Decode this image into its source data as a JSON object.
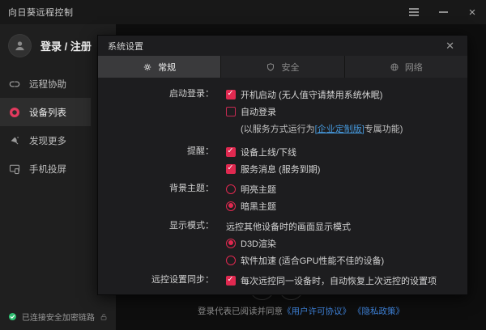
{
  "titlebar": {
    "title": "向日葵远程控制"
  },
  "sidebar": {
    "login": "登录 / 注册",
    "nav": [
      {
        "label": "远程协助"
      },
      {
        "label": "设备列表"
      },
      {
        "label": "发现更多"
      },
      {
        "label": "手机投屏"
      }
    ],
    "secure_status": "已连接安全加密链路"
  },
  "main": {
    "agreement_prefix": "登录代表已阅读并同意",
    "license_link": "《用户许可协议》",
    "privacy_link": "《隐私政策》"
  },
  "dialog": {
    "title": "系统设置",
    "close": "✕",
    "tabs": [
      {
        "label": "常规"
      },
      {
        "label": "安全"
      },
      {
        "label": "网络"
      }
    ],
    "startup": {
      "label": "启动登录：",
      "boot_text": "开机启动 (无人值守请禁用系统休眠)",
      "boot_checked": true,
      "autologin_text": "自动登录",
      "autologin_checked": false,
      "note_prefix": "(以服务方式运行为",
      "note_link": "[企业定制版]",
      "note_suffix": "专属功能)"
    },
    "remind": {
      "label": "提醒：",
      "online_text": "设备上线/下线",
      "online_checked": true,
      "service_text": "服务消息 (服务到期)",
      "service_checked": true
    },
    "theme": {
      "label": "背景主题：",
      "light_text": "明亮主题",
      "light_selected": false,
      "dark_text": "暗黑主题",
      "dark_selected": true
    },
    "display": {
      "label": "显示模式：",
      "desc": "远控其他设备时的画面显示模式",
      "d3d_text": "D3D渲染",
      "d3d_selected": true,
      "soft_text": "软件加速 (适合GPU性能不佳的设备)",
      "soft_selected": false
    },
    "sync": {
      "label": "远控设置同步：",
      "restore_text": "每次远控同一设备时，自动恢复上次远控的设置项",
      "restore_checked": true
    }
  },
  "colors": {
    "accent": "#e02950",
    "link_blue": "#4596d8",
    "agreement_blue": "#3f84dc",
    "secure_green": "#2fbf71"
  }
}
